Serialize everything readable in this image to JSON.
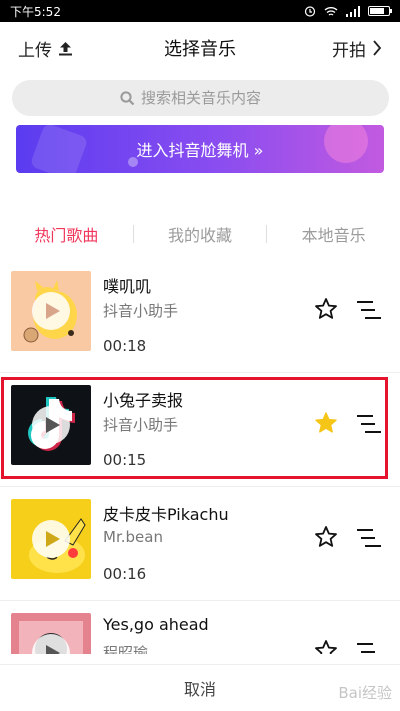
{
  "status_bar": {
    "time": "下午5:52",
    "battery_level": 0.8
  },
  "header": {
    "upload_label": "上传",
    "title": "选择音乐",
    "shoot_label": "开拍"
  },
  "search": {
    "placeholder": "搜索相关音乐内容"
  },
  "banner": {
    "label": "进入抖音尬舞机 »"
  },
  "tabs": [
    {
      "label": "热门歌曲",
      "active": true
    },
    {
      "label": "我的收藏",
      "active": false
    },
    {
      "label": "本地音乐",
      "active": false
    }
  ],
  "songs": [
    {
      "name": "噗叽叽",
      "artist": "抖音小助手",
      "duration": "00:18",
      "favorited": false
    },
    {
      "name": "小兔子卖报",
      "artist": "抖音小助手",
      "duration": "00:15",
      "favorited": true
    },
    {
      "name": "皮卡皮卡Pikachu",
      "artist": "Mr.bean",
      "duration": "00:16",
      "favorited": false
    },
    {
      "name": "Yes,go ahead",
      "artist": "程昭瑜",
      "duration": "",
      "favorited": false
    }
  ],
  "footer": {
    "cancel_label": "取消"
  },
  "watermark": "Bai经验",
  "colors": {
    "accent": "#f0385c",
    "favorite": "#f5c518",
    "highlight_border": "#e5132c"
  }
}
